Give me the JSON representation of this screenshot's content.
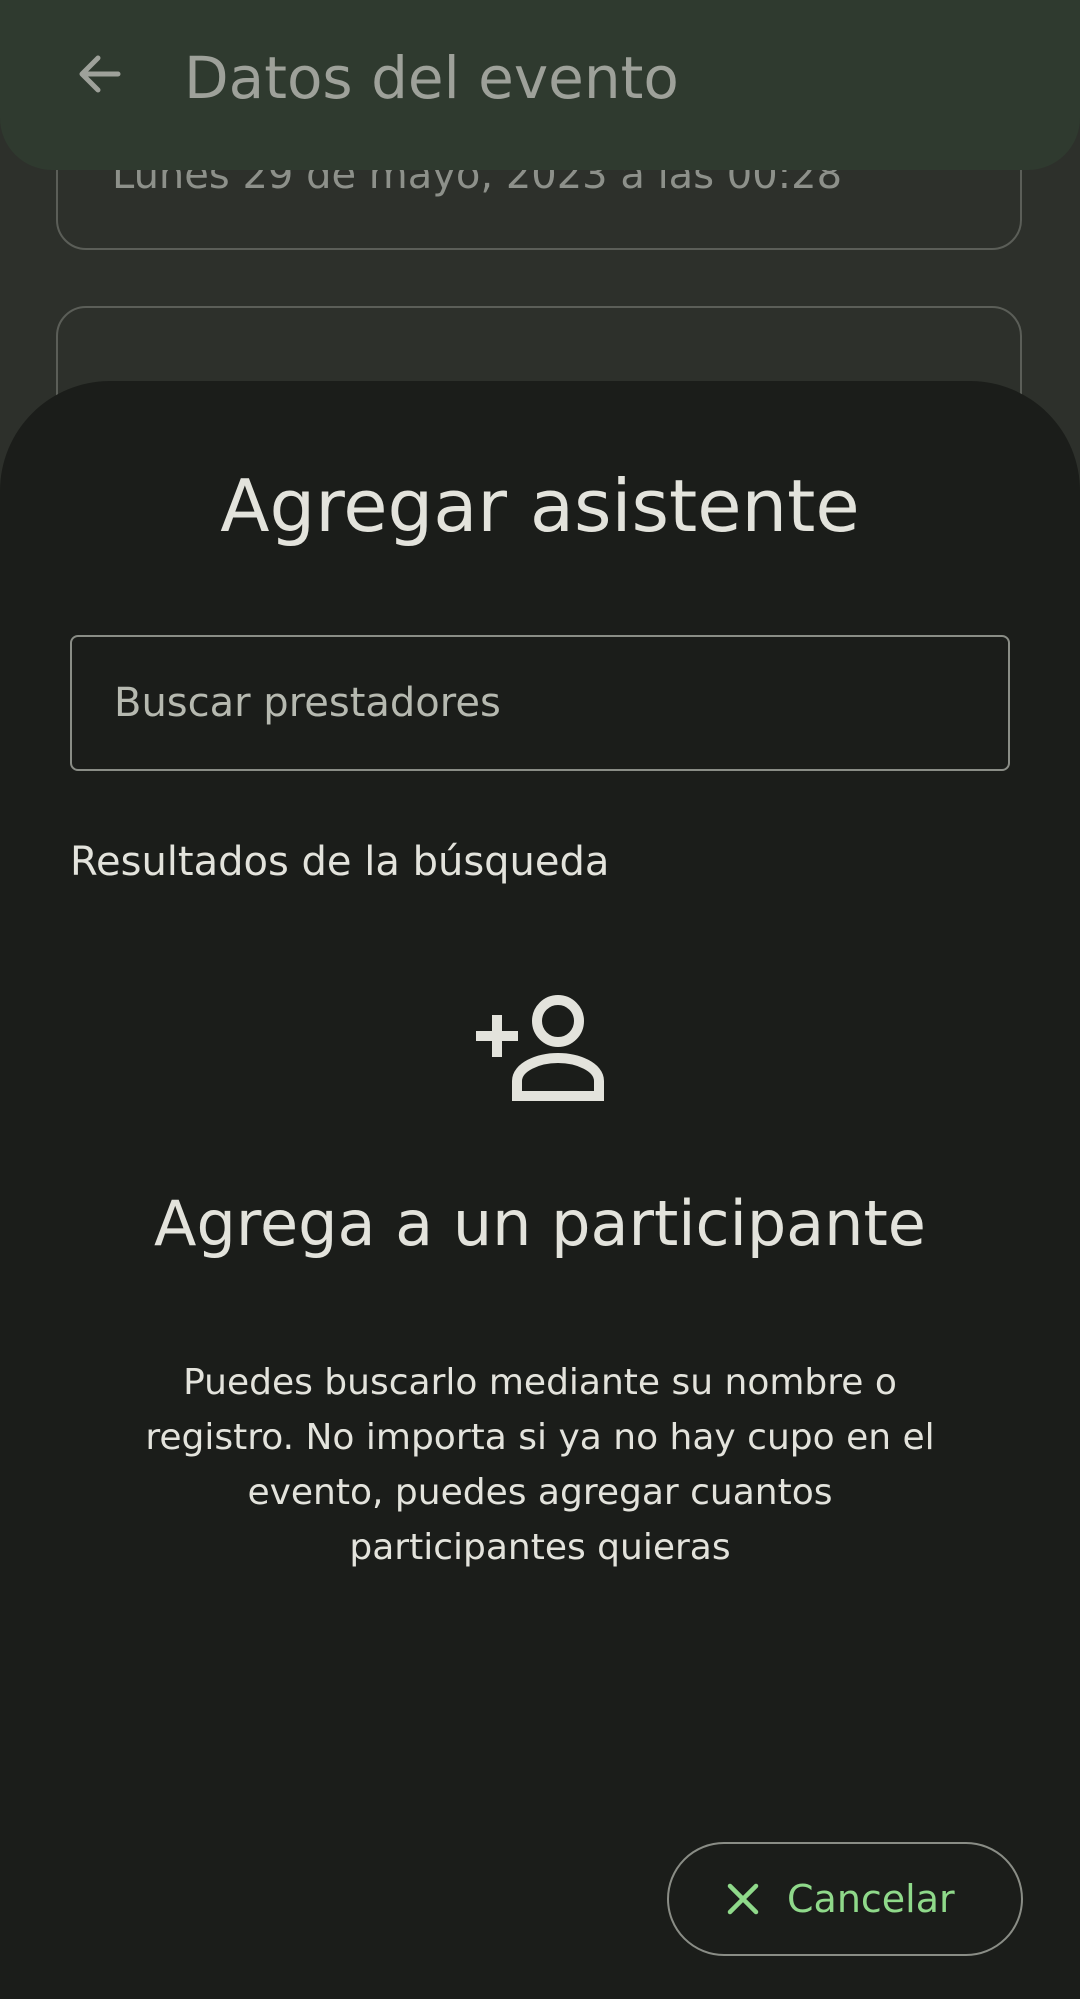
{
  "app_bar": {
    "title": "Datos del evento",
    "back_icon": "arrow-back-icon"
  },
  "background": {
    "date_text": "Lunes 29 de mayo, 2023 a las 00:28"
  },
  "sheet": {
    "title": "Agregar asistente",
    "search": {
      "placeholder": "Buscar prestadores",
      "value": ""
    },
    "results_label": "Resultados de la búsqueda",
    "empty_state": {
      "icon": "person-add-icon",
      "title": "Agrega a un participante",
      "description": "Puedes buscarlo mediante su nombre o registro. No importa si ya no hay cupo en el evento, puedes agregar cuantos participantes quieras"
    },
    "cancel_button": {
      "label": "Cancelar",
      "icon": "close-icon"
    }
  },
  "colors": {
    "accent": "#8fd98a",
    "sheet_background": "#1b1d1a",
    "app_bar_background": "#2f3a2f"
  }
}
